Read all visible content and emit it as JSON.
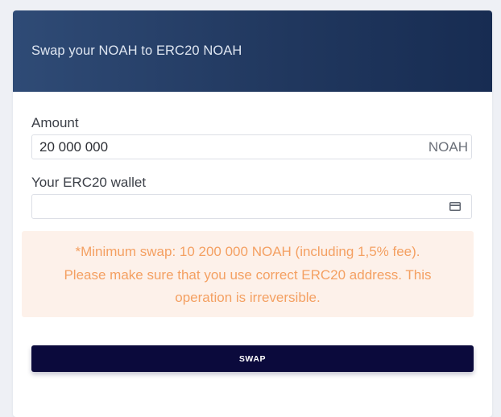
{
  "header": {
    "title": "Swap your NOAH to ERC20 NOAH"
  },
  "form": {
    "amount_label": "Amount",
    "amount_value": "20 000 000",
    "amount_suffix": "NOAH",
    "wallet_label": "Your ERC20 wallet",
    "wallet_value": "",
    "wallet_icon": "credit-card-icon"
  },
  "notice": {
    "lines": [
      "*Minimum swap: 10 200 000 NOAH (including 1,5% fee).",
      "Please make sure that you use correct ERC20 address. This",
      "operation is irreversible."
    ]
  },
  "swap_button": {
    "label": "SWAP"
  },
  "colors": {
    "header_start": "#2f4b76",
    "header_end": "#172c52",
    "button": "#0b0a3c",
    "notice_bg": "#fdf1ea",
    "notice_text": "#f4a062"
  }
}
